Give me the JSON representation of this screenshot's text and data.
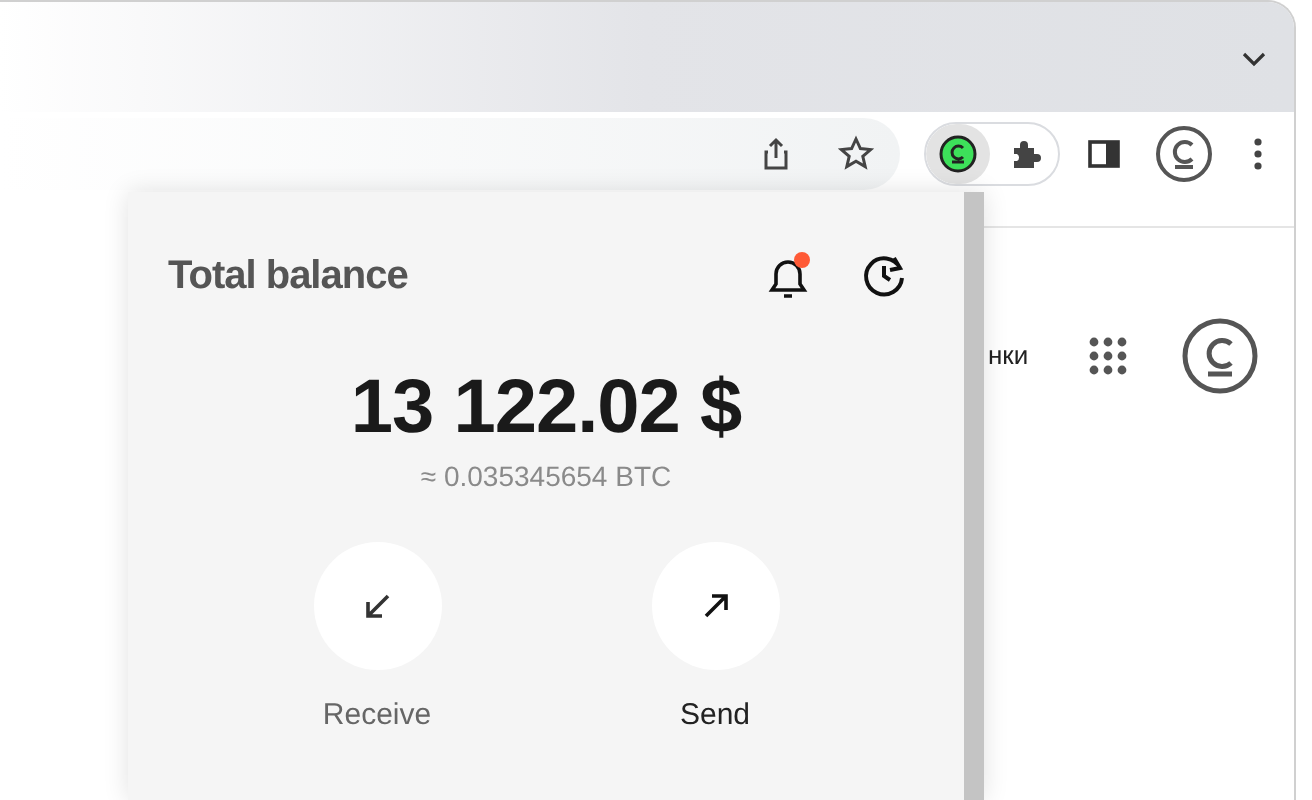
{
  "page": {
    "header_text": "нки"
  },
  "popup": {
    "title": "Total balance",
    "notifications": {
      "unread": true
    },
    "balance": "13 122.02 $",
    "balance_btc": "≈ 0.035345654 BTC",
    "actions": [
      {
        "kind": "receive",
        "label": "Receive"
      },
      {
        "kind": "send",
        "label": "Send"
      }
    ]
  }
}
